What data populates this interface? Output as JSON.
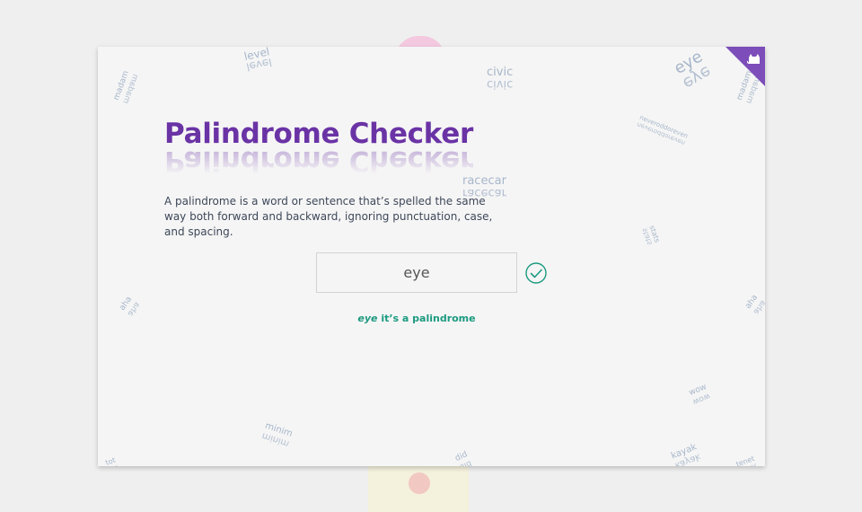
{
  "app": {
    "title": "Palindrome Checker",
    "description": "A palindrome is a word or sentence that’s spelled the same way both forward and backward, ignoring punctuation, case, and spacing."
  },
  "input": {
    "value": "eye",
    "placeholder": ""
  },
  "result": {
    "word": "eye",
    "message": " it’s a palindrome",
    "status": "valid"
  },
  "background_words": [
    "madam",
    "level",
    "civic",
    "eye",
    "madam",
    "neveroddoreven",
    "racecar",
    "stats",
    "aha",
    "aha",
    "wow",
    "minim",
    "kayak",
    "did",
    "tot",
    "tenet"
  ],
  "colors": {
    "accent": "#6a33a5",
    "ribbon": "#7d4dba",
    "success": "#1c9a80",
    "deco_text": "#9fb0c6"
  },
  "icons": {
    "corner": "cat-icon",
    "status": "checkmark-circle-icon"
  }
}
